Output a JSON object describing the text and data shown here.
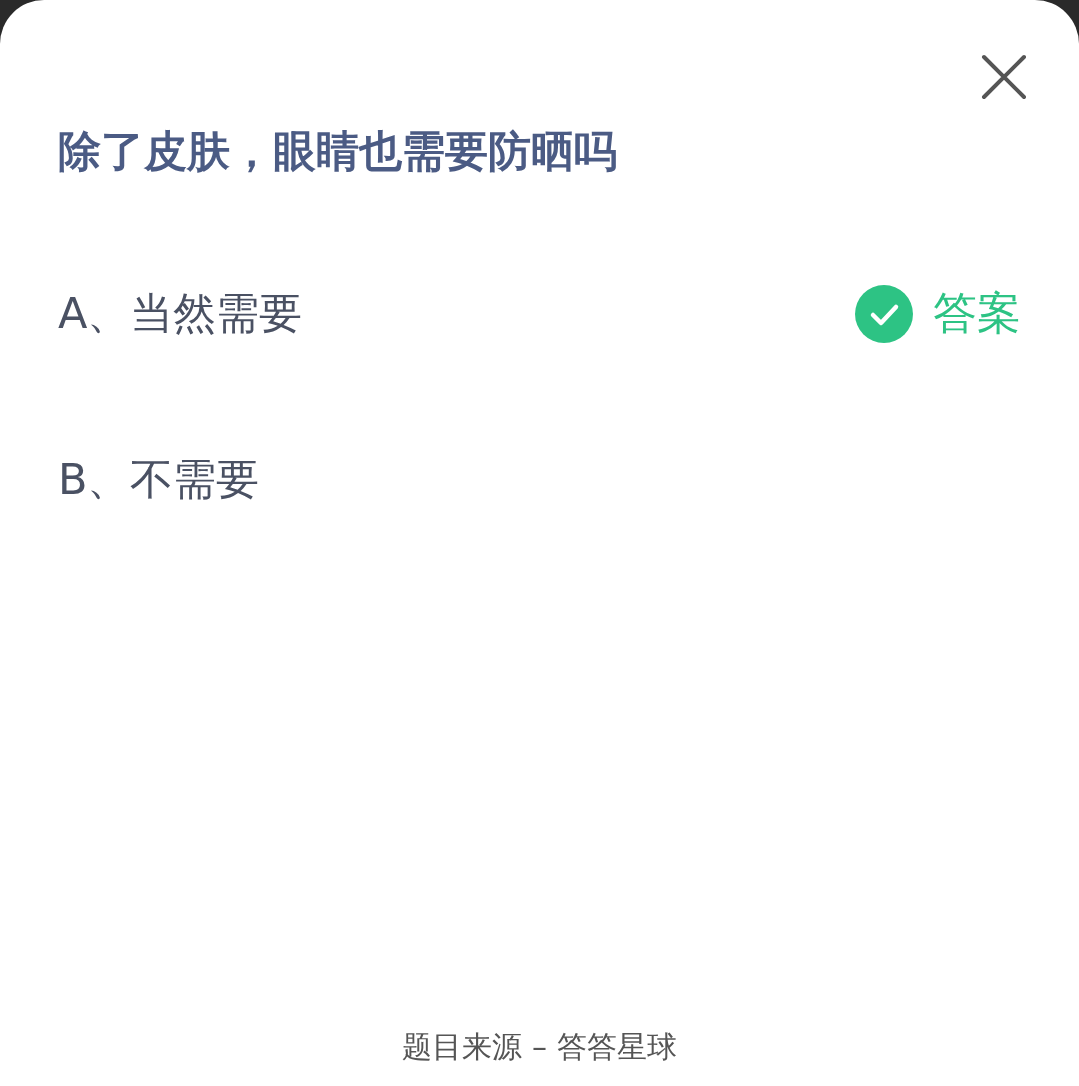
{
  "question": "除了皮肤，眼睛也需要防晒吗",
  "options": [
    {
      "text": "A、当然需要",
      "correct": true
    },
    {
      "text": "B、不需要",
      "correct": false
    }
  ],
  "answer_label": "答案",
  "source": "题目来源 – 答答星球"
}
